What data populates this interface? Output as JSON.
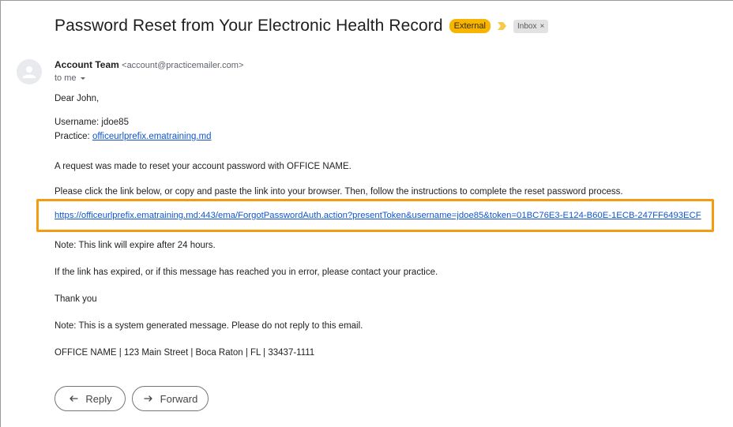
{
  "email": {
    "subject": "Password Reset from Your Electronic Health Record",
    "labels": {
      "external": "External",
      "inbox": "Inbox",
      "inbox_close": "×"
    },
    "sender_name": "Account Team",
    "sender_email": "<account@practicemailer.com>",
    "recipient_line": "to me",
    "body": {
      "greeting": "Dear John,",
      "username_line": "Username: jdoe85",
      "practice_label": "Practice: ",
      "practice_link": "officeurlprefix.ematraining.md",
      "request_line": "A request was made to reset your account password with OFFICE NAME.",
      "instructions": "Please click the link below, or copy and paste the link into your browser. Then, follow the instructions to complete the reset password process.",
      "reset_link": "https://officeurlprefix.ematraining.md:443/ema/ForgotPasswordAuth.action?presentToken&username=jdoe85&token=01BC76E3-E124-B60E-1ECB-247FF6493ECF",
      "expiry_note": "Note: This link will expire after 24 hours.",
      "expired_note": "If the link has expired, or if this message has reached you in error, please contact your practice.",
      "thanks": "Thank you",
      "system_note": "Note: This is a system generated message. Please do not reply to this email.",
      "footer": "OFFICE NAME | 123 Main Street | Boca Raton | FL | 33437-1111"
    }
  },
  "actions": {
    "reply_label": "Reply",
    "forward_label": "Forward"
  },
  "colors": {
    "external_label": "#f7b500",
    "highlight_border": "#f39c12",
    "link": "#1155cc"
  },
  "icons": [
    "importance-marker-icon",
    "person-avatar-icon",
    "chevron-down-icon",
    "reply-icon",
    "forward-icon"
  ]
}
